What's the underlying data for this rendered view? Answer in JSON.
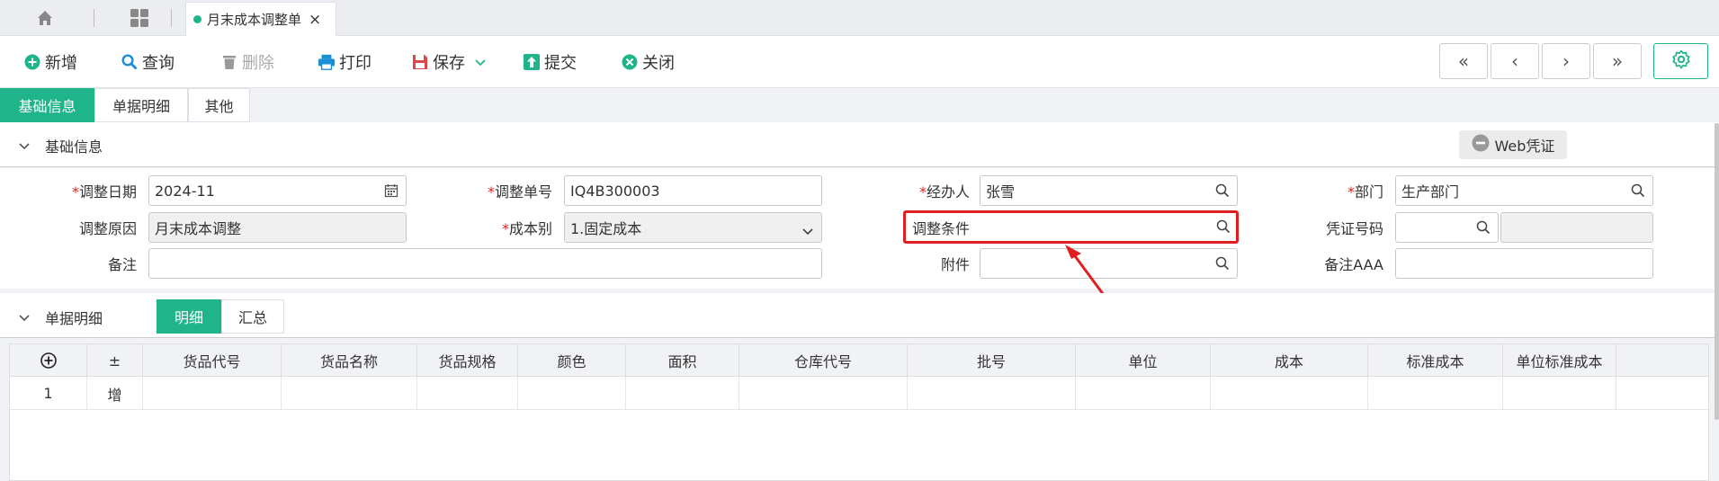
{
  "tabs": {
    "doc_title": "月末成本调整单",
    "close": "×"
  },
  "toolbar": {
    "new": "新增",
    "query": "查询",
    "delete": "删除",
    "print": "打印",
    "save": "保存",
    "submit": "提交",
    "close": "关闭",
    "first": "«",
    "prev": "‹",
    "next": "›",
    "last": "»"
  },
  "subtabs": [
    "基础信息",
    "单据明细",
    "其他"
  ],
  "basic": {
    "title": "基础信息",
    "web_voucher": "Web凭证",
    "req": "*",
    "fields": {
      "adjust_date_label": "调整日期",
      "adjust_date": "2024-11",
      "adjust_no_label": "调整单号",
      "adjust_no": "IQ4B300003",
      "handler_label": "经办人",
      "handler": "张雪",
      "dept_label": "部门",
      "dept": "生产部门",
      "reason_label": "调整原因",
      "reason": "月末成本调整",
      "cost_type_label": "成本别",
      "cost_type": "1.固定成本",
      "condition_label": "调整条件",
      "condition": "",
      "voucher_label": "凭证号码",
      "voucher": "",
      "remark_label": "备注",
      "remark": "",
      "attach_label": "附件",
      "attach": "",
      "remark_aaa_label": "备注AAA",
      "remark_aaa": ""
    }
  },
  "detail": {
    "title": "单据明细",
    "tabs": [
      "明细",
      "汇总"
    ],
    "columns": [
      "+",
      "±",
      "货品代号",
      "货品名称",
      "货品规格",
      "颜色",
      "面积",
      "仓库代号",
      "批号",
      "单位",
      "成本",
      "标准成本",
      "单位标准成本"
    ],
    "rows": [
      [
        "1",
        "增",
        "",
        "",
        "",
        "",
        "",
        "",
        "",
        "",
        "",
        "",
        ""
      ]
    ]
  },
  "colors": {
    "accent": "#20b48a",
    "highlight": "#e02020"
  }
}
